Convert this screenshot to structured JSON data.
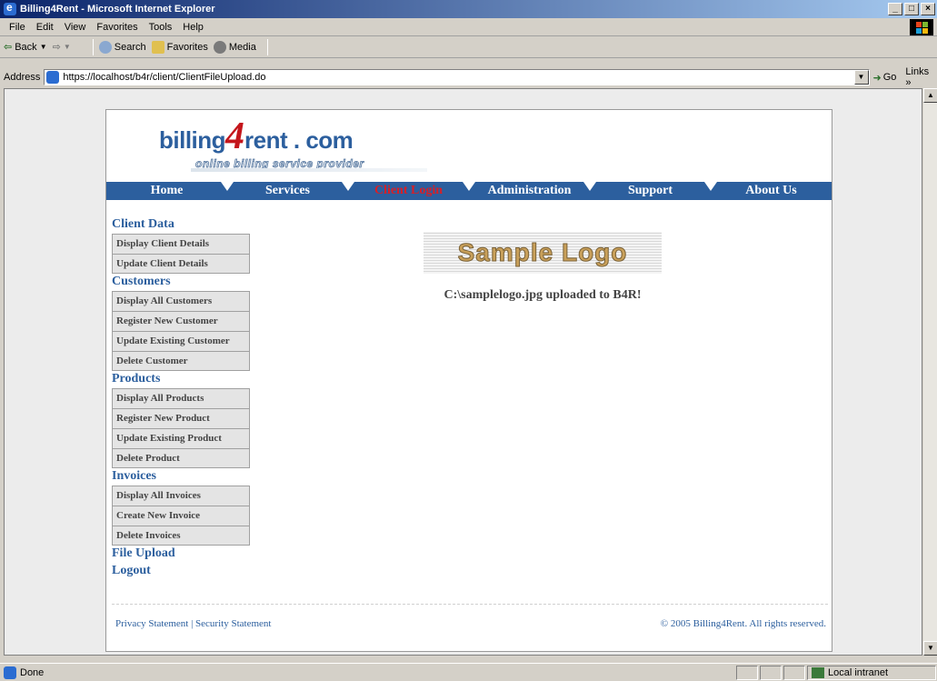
{
  "window": {
    "title": "Billing4Rent - Microsoft Internet Explorer",
    "controls": [
      "_",
      "□",
      "×"
    ]
  },
  "menu": [
    "File",
    "Edit",
    "View",
    "Favorites",
    "Tools",
    "Help"
  ],
  "toolbar": {
    "back": "Back",
    "search": "Search",
    "favorites": "Favorites",
    "media": "Media"
  },
  "address": {
    "label": "Address",
    "url": "https://localhost/b4r/client/ClientFileUpload.do",
    "go": "Go",
    "links": "Links"
  },
  "site": {
    "logo_main_a": "billing",
    "logo_four": "4",
    "logo_main_b": "rent . com",
    "logo_tagline": "online billing service provider",
    "nav": [
      {
        "label": "Home"
      },
      {
        "label": "Services"
      },
      {
        "label": "Client Login"
      },
      {
        "label": "Administration"
      },
      {
        "label": "Support"
      },
      {
        "label": "About Us"
      }
    ],
    "sidebar": {
      "client_data": {
        "title": "Client Data",
        "links": [
          "Display Client Details",
          "Update Client Details"
        ]
      },
      "customers": {
        "title": "Customers",
        "links": [
          "Display All Customers",
          "Register New Customer",
          "Update Existing Customer",
          "Delete Customer"
        ]
      },
      "products": {
        "title": "Products",
        "links": [
          "Display All Products",
          "Register New Product",
          "Update Existing Product",
          "Delete Product"
        ]
      },
      "invoices": {
        "title": "Invoices",
        "links": [
          "Display All Invoices",
          "Create New Invoice",
          "Delete Invoices"
        ]
      },
      "file_upload": "File Upload",
      "logout": "Logout"
    },
    "content": {
      "image_text": "Sample Logo",
      "message": "C:\\samplelogo.jpg uploaded to B4R!"
    },
    "footer": {
      "privacy": "Privacy Statement",
      "separator": "|",
      "security": "Security Statement",
      "copyright": "© 2005 Billing4Rent. All rights reserved."
    }
  },
  "status": {
    "text": "Done",
    "zone": "Local intranet"
  },
  "colors": {
    "brand_blue": "#2c5f9e",
    "active_nav": "#d81f26"
  }
}
